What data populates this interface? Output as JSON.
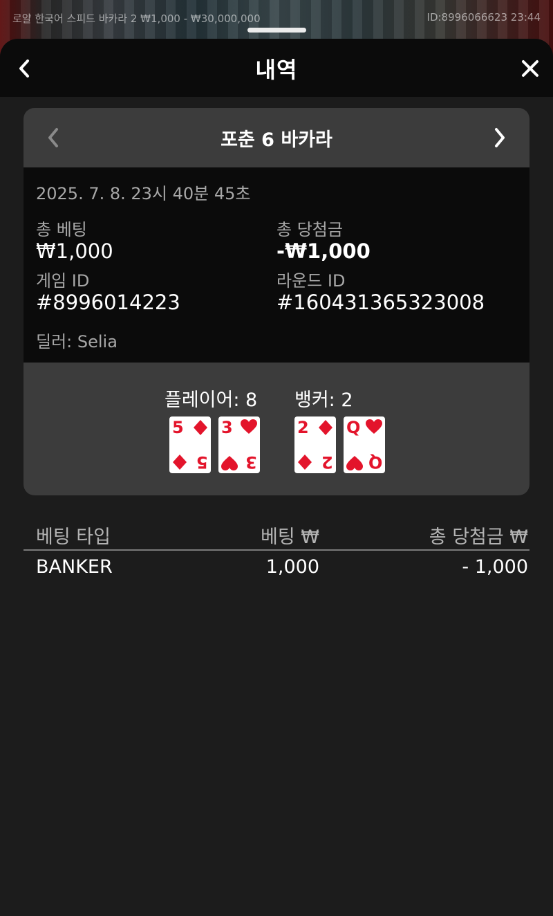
{
  "game_bar": {
    "left_text": "로얄 한국어 스피드 바카라 2  ₩1,000 - ₩30,000,000",
    "right_text": "ID:8996066623  23:44"
  },
  "header": {
    "title": "내역",
    "back_icon": "chevron-left-icon",
    "close_icon": "close-icon"
  },
  "record": {
    "game_name": "포춘 6 바카라",
    "datetime": "2025. 7. 8. 23시 40분 45초",
    "total_bet_label": "총 베팅",
    "total_bet_value": "₩1,000",
    "total_win_label": "총 당첨금",
    "total_win_value": "-₩1,000",
    "game_id_label": "게임 ID",
    "game_id_value": "#8996014223",
    "round_id_label": "라운드 ID",
    "round_id_value": "#160431365323008",
    "dealer": "딜러: Selia"
  },
  "hands": {
    "player_label": "플레이어: 8",
    "banker_label": "뱅커: 2",
    "player_cards": [
      {
        "rank": "5",
        "suit": "diamond"
      },
      {
        "rank": "3",
        "suit": "heart"
      }
    ],
    "banker_cards": [
      {
        "rank": "2",
        "suit": "diamond"
      },
      {
        "rank": "Q",
        "suit": "heart"
      }
    ]
  },
  "bets_table": {
    "headers": [
      "베팅 타입",
      "베팅 ₩",
      "총 당첨금 ₩"
    ],
    "rows": [
      [
        "BANKER",
        "1,000",
        "- 1,000"
      ]
    ]
  },
  "colors": {
    "card_suit": "#e3142b",
    "panel_bg": "#3c3c3c",
    "sheet_bg": "#1c1c1c"
  }
}
